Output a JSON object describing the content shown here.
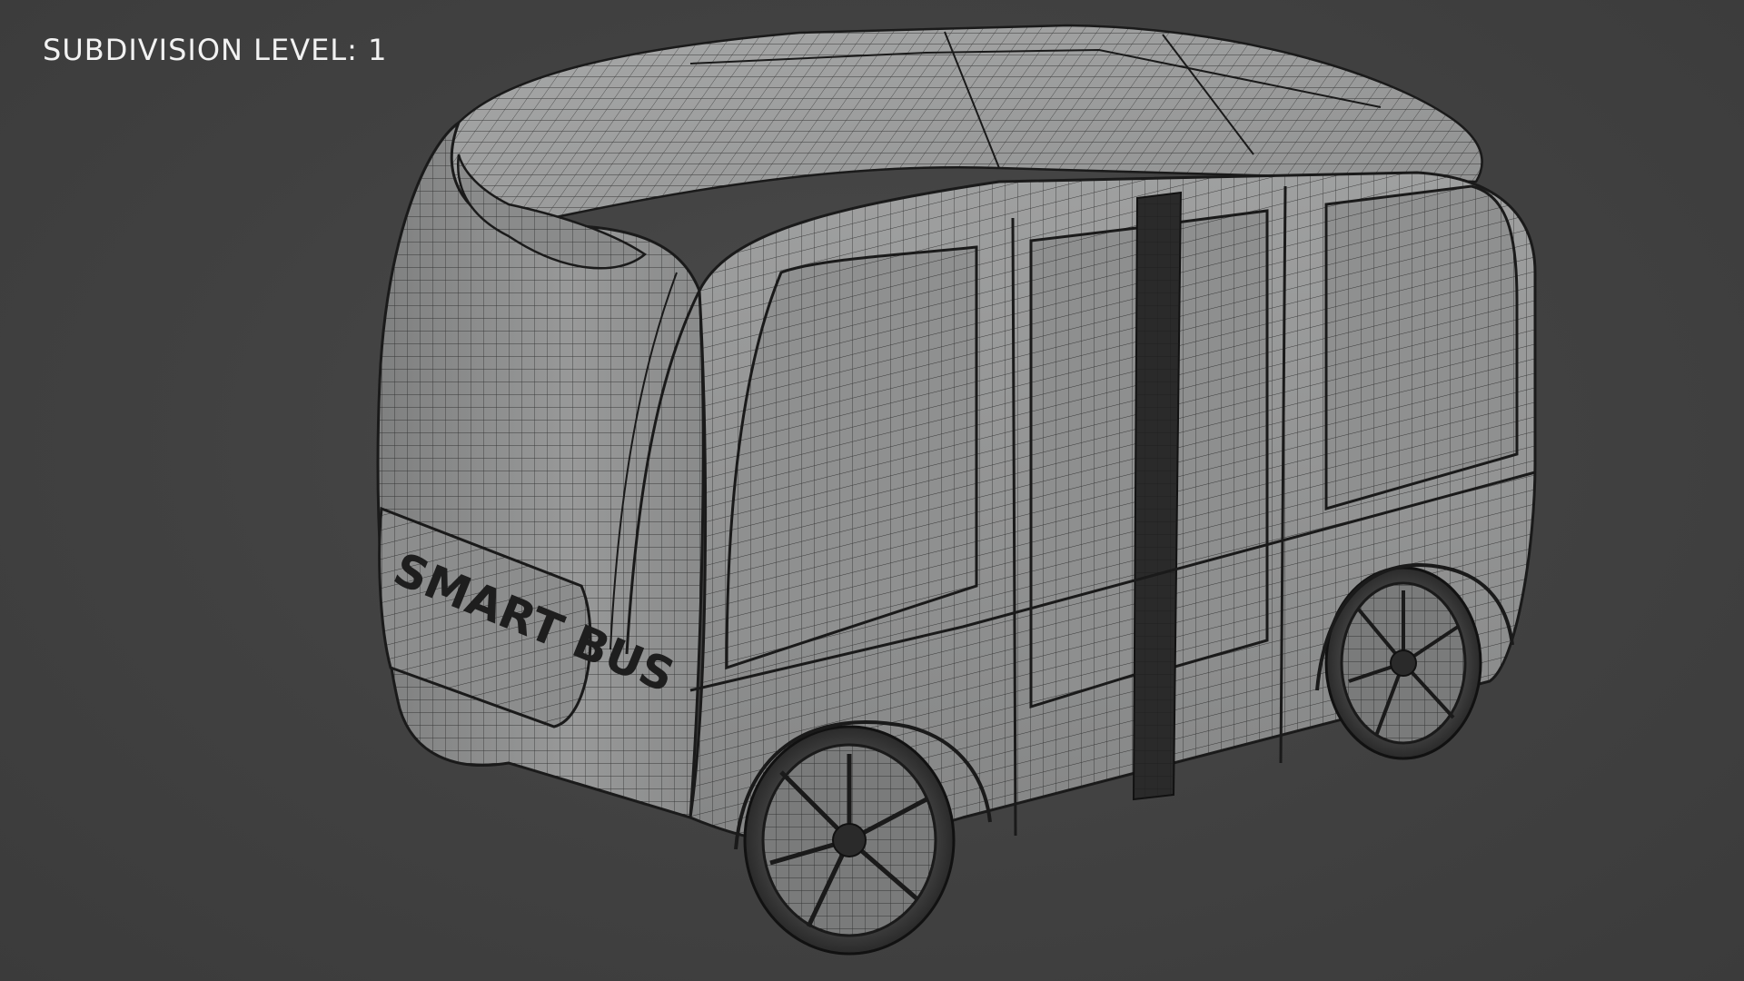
{
  "viewport": {
    "overlay_label": "SUBDIVISION LEVEL: 1",
    "background_color": "#414141"
  },
  "model": {
    "decal_text": "SMART BUS",
    "body_color": "#8e8f8f",
    "wire_color": "#1c1c1c",
    "icon": "bus-wireframe"
  }
}
